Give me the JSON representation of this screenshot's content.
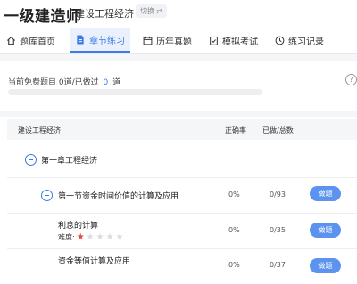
{
  "header": {
    "title": "一级建造师",
    "subject": "建设工程经济",
    "switch_label": "切换"
  },
  "tabs": [
    {
      "label": "题库首页",
      "icon": "home-icon",
      "active": false
    },
    {
      "label": "章节练习",
      "icon": "document-icon",
      "active": true
    },
    {
      "label": "历年真题",
      "icon": "calendar-icon",
      "active": false
    },
    {
      "label": "模拟考试",
      "icon": "clipboard-check-icon",
      "active": false
    },
    {
      "label": "练习记录",
      "icon": "clock-icon",
      "active": false
    }
  ],
  "progress": {
    "prefix": "当前免费题目",
    "total": "0",
    "middle": "道/已做过",
    "done": "0",
    "suffix": "道",
    "fraction": 0
  },
  "table": {
    "headers": {
      "name": "建设工程经济",
      "rate": "正确率",
      "done": "已做/总数"
    },
    "rows": [
      {
        "name": "第一章工程经济"
      },
      {
        "name": "第一节资金时间价值的计算及应用",
        "rate": "0%",
        "done": "0/93",
        "action": "做题"
      },
      {
        "name": "利息的计算",
        "difficulty_label": "难度:",
        "stars": 1,
        "max_stars": 5,
        "rate": "0%",
        "done": "0/35",
        "action": "做题"
      },
      {
        "name": "资金等值计算及应用",
        "rate": "0%",
        "done": "0/37",
        "action": "做题"
      }
    ]
  },
  "colors": {
    "accent": "#3a7bea",
    "button": "#5b93ee",
    "star": "#e8443a"
  }
}
